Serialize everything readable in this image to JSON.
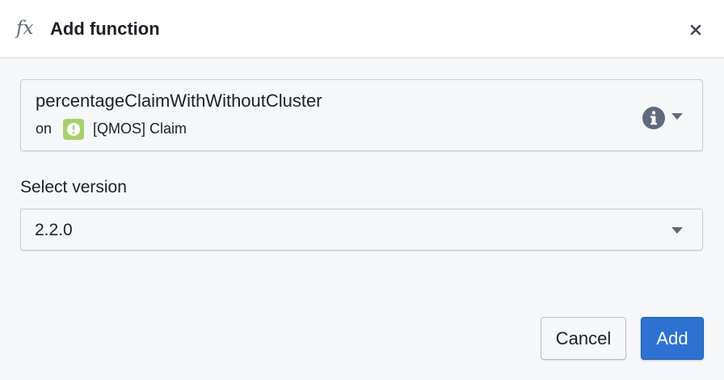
{
  "dialog": {
    "title": "Add function",
    "title_icon": "fx-icon",
    "close_icon": "close-icon"
  },
  "function_card": {
    "name": "percentageClaimWithWithoutCluster",
    "on_prefix": "on",
    "object_icon": "warning-object-icon",
    "object_icon_color": "#a7d16b",
    "object_label": "[QMOS] Claim",
    "info_icon": "info-icon",
    "caret_icon": "caret-down-icon"
  },
  "version": {
    "label": "Select version",
    "selected": "2.2.0",
    "caret_icon": "caret-down-icon"
  },
  "footer": {
    "cancel_label": "Cancel",
    "add_label": "Add",
    "add_color": "#2d72d2"
  }
}
